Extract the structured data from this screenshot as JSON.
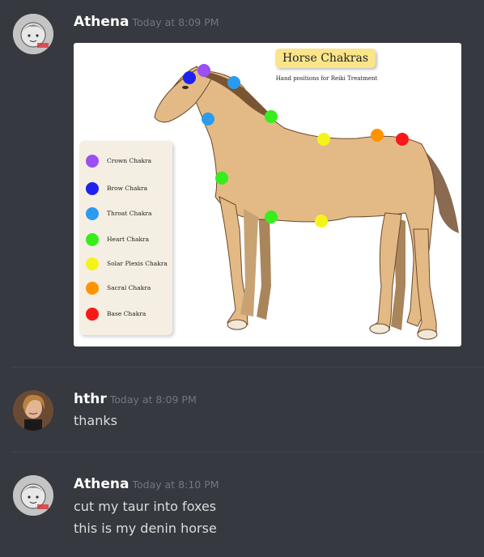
{
  "messages": [
    {
      "author": "Athena",
      "timestamp": "Today at 8:09 PM"
    },
    {
      "author": "hthr",
      "timestamp": "Today at 8:09 PM",
      "lines": [
        "thanks"
      ]
    },
    {
      "author": "Athena",
      "timestamp": "Today at 8:10 PM",
      "lines": [
        "cut my taur into foxes",
        "this is my denin horse"
      ]
    }
  ],
  "attachment": {
    "title": "Horse Chakras",
    "subtitle": "Hand positions for Reiki Treatment",
    "legend": [
      {
        "label": "Crown Chakra",
        "color": "#9b4ff5"
      },
      {
        "label": "Brow Chakra",
        "color": "#1f22ee"
      },
      {
        "label": "Throat Chakra",
        "color": "#2b9bf0"
      },
      {
        "label": "Heart Chakra",
        "color": "#36ee1d"
      },
      {
        "label": "Solar Plexis Chakra",
        "color": "#f4f41a"
      },
      {
        "label": "Sacral Chakra",
        "color": "#ff9300"
      },
      {
        "label": "Base Chakra",
        "color": "#f81818"
      }
    ]
  }
}
